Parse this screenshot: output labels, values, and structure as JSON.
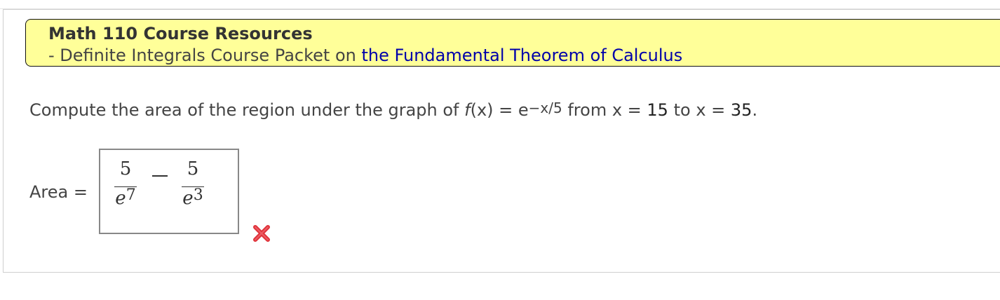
{
  "banner": {
    "title": "Math 110 Course Resources",
    "subtitle_prefix": "- Definite Integrals Course Packet on ",
    "link_text": "the Fundamental Theorem of Calculus",
    "background": "#ffff99",
    "link_color": "#0000aa"
  },
  "question": {
    "text_before": "Compute the area of the region under the graph of ",
    "func_name": "f",
    "func_arg": "(x)",
    "equals": " = e",
    "exponent": "−x/5",
    "from_text": " from ",
    "var1": "x",
    "eq1": " = ",
    "lower": "15",
    "to_text": " to ",
    "var2": "x",
    "eq2": " = ",
    "upper": "35",
    "period": "."
  },
  "answer": {
    "label": "Area =",
    "term1": {
      "numerator": "5",
      "denominator_base": "e",
      "denominator_exp": "7"
    },
    "operator": "−",
    "term2": {
      "numerator": "5",
      "denominator_base": "e",
      "denominator_exp": "3"
    },
    "status": "incorrect",
    "status_icon": "x-mark-icon",
    "status_color": "#e0323a"
  }
}
